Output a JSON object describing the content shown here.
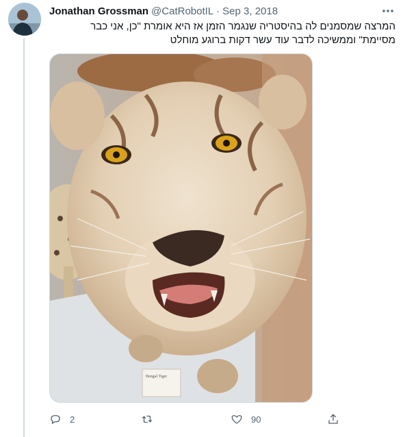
{
  "tweet": {
    "author_name": "Jonathan Grossman",
    "handle": "@CatRobotIL",
    "separator": "·",
    "date": "Sep 3, 2018",
    "text_line1": "המרצה שמסמנים לה בהיסטריה שנגמר הזמן אז היא אומרת \"כן, אני כבר",
    "text_line2": "מסיימת\" וממשיכה לדבר עוד עשר דקות ברוגע מוחלט",
    "media_label": "Bengal Tiger",
    "actions": {
      "reply_count": "2",
      "retweet_count": "",
      "like_count": "90"
    }
  },
  "icons": {
    "more": "more-icon",
    "reply": "reply-icon",
    "retweet": "retweet-icon",
    "like": "heart-icon",
    "share": "share-icon"
  },
  "colors": {
    "secondary_text": "#536471",
    "thread_line": "#cfd9de"
  }
}
